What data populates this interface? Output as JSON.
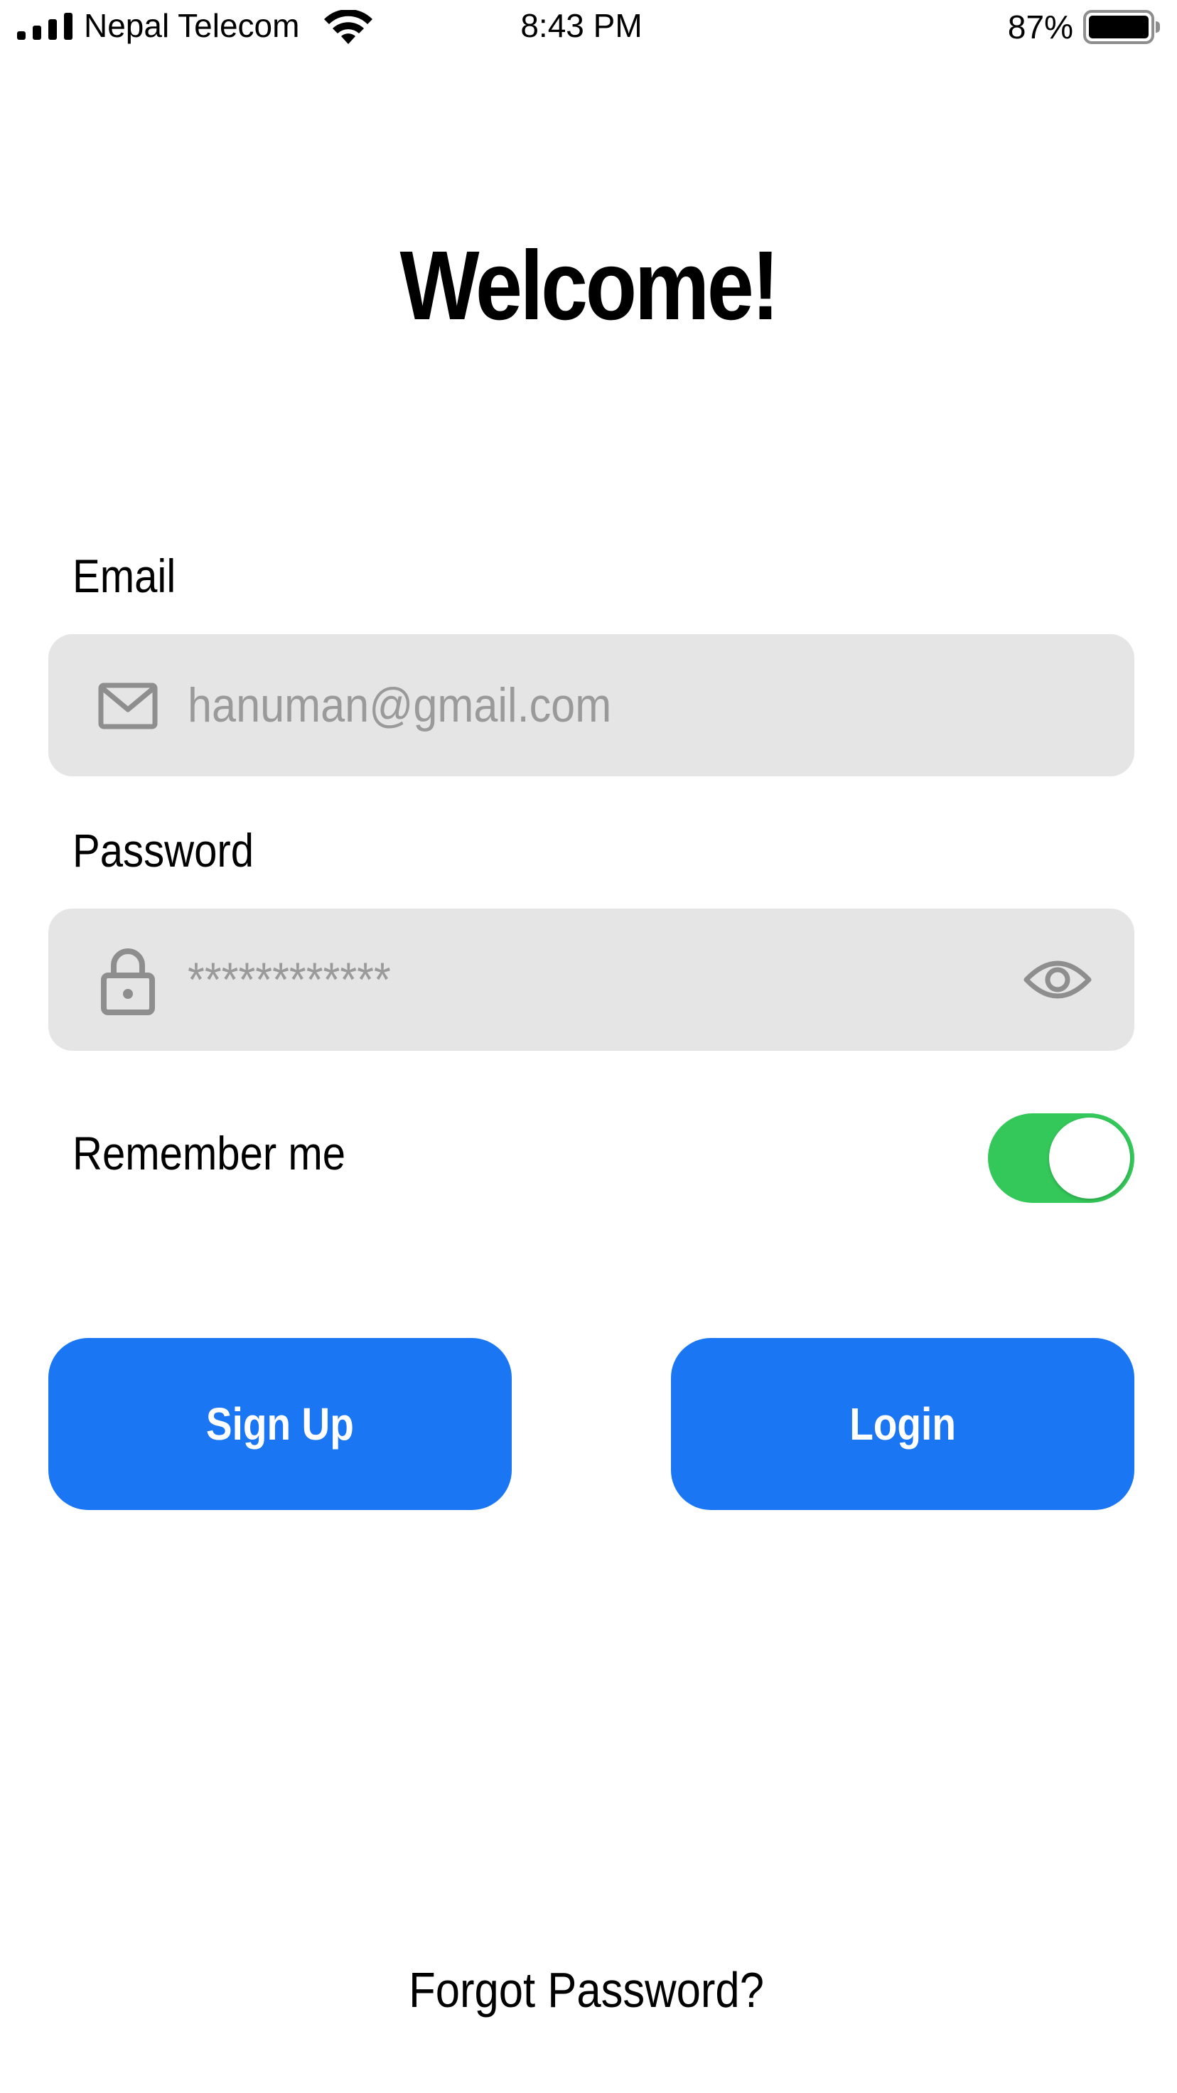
{
  "status_bar": {
    "carrier": "Nepal Telecom",
    "time": "8:43 PM",
    "battery_percent": "87%",
    "battery_level": 0.87
  },
  "title": "Welcome!",
  "email": {
    "label": "Email",
    "placeholder": "hanuman@gmail.com",
    "icon": "mail-icon"
  },
  "password": {
    "label": "Password",
    "value": "************",
    "icon": "lock-icon",
    "toggle_icon": "eye-icon"
  },
  "remember_me": {
    "label": "Remember me",
    "enabled": true
  },
  "buttons": {
    "signup": "Sign Up",
    "login": "Login"
  },
  "forgot_password": "Forgot Password?",
  "colors": {
    "primary": "#1a76f2",
    "toggle_on": "#34c759",
    "field_background": "#e5e5e5",
    "placeholder_text": "#9a9a9a"
  }
}
